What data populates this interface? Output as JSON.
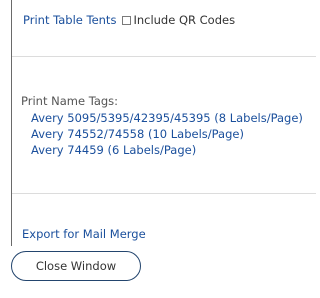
{
  "table_tents": {
    "link": "Print Table Tents",
    "qr_label": "Include QR Codes",
    "qr_checked": false
  },
  "name_tags": {
    "label": "Print Name Tags:",
    "items": [
      "Avery 5095/5395/42395/45395 (8 Labels/Page)",
      "Avery 74552/74558 (10 Labels/Page)",
      "Avery 74459 (6 Labels/Page)"
    ]
  },
  "export": {
    "link": "Export for Mail Merge"
  },
  "close_button": {
    "label": "Close Window"
  },
  "colors": {
    "link": "#1a4f9c",
    "button_border": "#23456e"
  }
}
